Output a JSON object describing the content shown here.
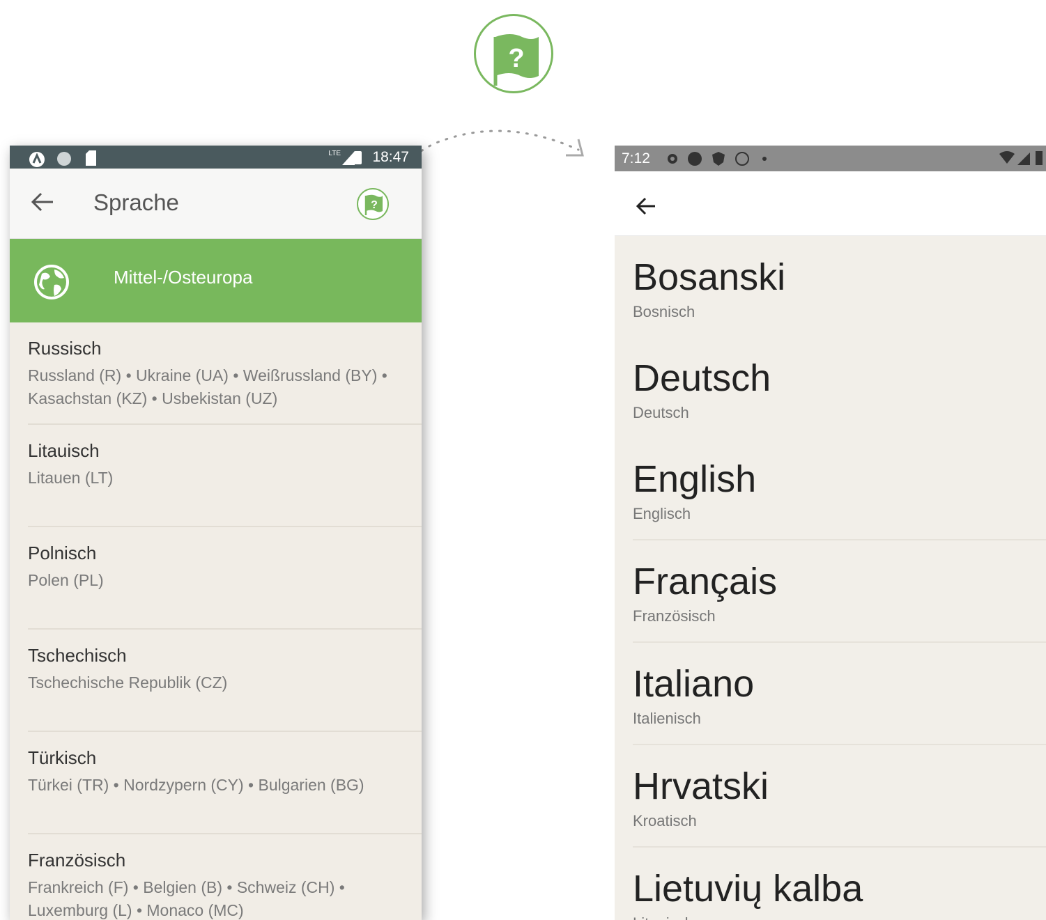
{
  "left_screen": {
    "status_bar": {
      "time": "18:47",
      "network": "LTE"
    },
    "toolbar": {
      "title": "Sprache"
    },
    "region": {
      "label": "Mittel-/Osteuropa"
    },
    "languages": [
      {
        "name": "Russisch",
        "countries": "Russland (R) • Ukraine (UA) • Weißrussland (BY) • Kasachstan (KZ) • Usbekistan (UZ)"
      },
      {
        "name": "Litauisch",
        "countries": "Litauen (LT)"
      },
      {
        "name": "Polnisch",
        "countries": "Polen (PL)"
      },
      {
        "name": "Tschechisch",
        "countries": "Tschechische Republik (CZ)"
      },
      {
        "name": "Türkisch",
        "countries": "Türkei (TR) • Nordzypern (CY) • Bulgarien (BG)"
      },
      {
        "name": "Französisch",
        "countries": "Frankreich (F) • Belgien (B) • Schweiz (CH) • Luxemburg (L) • Monaco (MC)"
      }
    ]
  },
  "right_screen": {
    "status_bar": {
      "time": "7:12"
    },
    "languages": [
      {
        "native": "Bosanski",
        "german": "Bosnisch"
      },
      {
        "native": "Deutsch",
        "german": "Deutsch"
      },
      {
        "native": "English",
        "german": "Englisch"
      },
      {
        "native": "Français",
        "german": "Französisch"
      },
      {
        "native": "Italiano",
        "german": "Italienisch"
      },
      {
        "native": "Hrvatski",
        "german": "Kroatisch"
      },
      {
        "native": "Lietuvių kalba",
        "german": "Litauisch"
      }
    ]
  },
  "colors": {
    "accent_green": "#78b85c",
    "status_bar_left": "#4a5a5e",
    "status_bar_right": "#8c8c8c"
  },
  "icons": [
    "flag-help-icon",
    "back-arrow-icon",
    "globe-icon",
    "battery-icon",
    "signal-icon",
    "wifi-icon",
    "gear-icon"
  ]
}
